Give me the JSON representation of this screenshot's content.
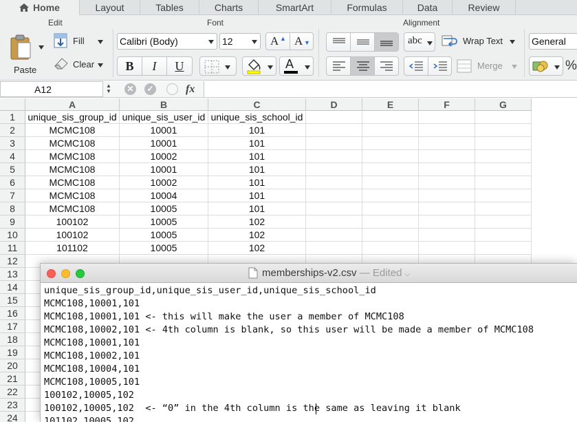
{
  "ribbon": {
    "tabs": [
      {
        "label": "Home",
        "active": true
      },
      {
        "label": "Layout"
      },
      {
        "label": "Tables"
      },
      {
        "label": "Charts"
      },
      {
        "label": "SmartArt"
      },
      {
        "label": "Formulas"
      },
      {
        "label": "Data"
      },
      {
        "label": "Review"
      }
    ],
    "groups": {
      "edit": "Edit",
      "font": "Font",
      "alignment": "Alignment"
    },
    "edit": {
      "paste": "Paste",
      "fill": "Fill",
      "clear": "Clear"
    },
    "font": {
      "name": "Calibri (Body)",
      "size": "12",
      "bold": "B",
      "italic": "I",
      "underline": "U",
      "increase": "A",
      "decrease": "A",
      "color_letter": "A"
    },
    "alignment": {
      "abc": "abc",
      "wrap_text": "Wrap Text",
      "merge": "Merge"
    },
    "number": {
      "format": "General",
      "percent": "%"
    }
  },
  "formula_bar": {
    "name_box": "A12",
    "fx": "fx",
    "value": ""
  },
  "sheet": {
    "columns": [
      "A",
      "B",
      "C",
      "D",
      "E",
      "F",
      "G"
    ],
    "rows": [
      "1",
      "2",
      "3",
      "4",
      "5",
      "6",
      "7",
      "8",
      "9",
      "10",
      "11",
      "12",
      "13",
      "14",
      "15",
      "16",
      "17",
      "18",
      "19",
      "20",
      "21",
      "22",
      "23",
      "24"
    ],
    "cells": [
      [
        "unique_sis_group_id",
        "unique_sis_user_id",
        "unique_sis_school_id"
      ],
      [
        "MCMC108",
        "10001",
        "101"
      ],
      [
        "MCMC108",
        "10001",
        "101"
      ],
      [
        "MCMC108",
        "10002",
        "101"
      ],
      [
        "MCMC108",
        "10001",
        "101"
      ],
      [
        "MCMC108",
        "10002",
        "101"
      ],
      [
        "MCMC108",
        "10004",
        "101"
      ],
      [
        "MCMC108",
        "10005",
        "101"
      ],
      [
        "100102",
        "10005",
        "102"
      ],
      [
        "100102",
        "10005",
        "102"
      ],
      [
        "101102",
        "10005",
        "102"
      ]
    ]
  },
  "editor": {
    "filename": "memberships-v2.csv",
    "status": "— Edited",
    "lines": [
      "unique_sis_group_id,unique_sis_user_id,unique_sis_school_id",
      "MCMC108,10001,101",
      "MCMC108,10001,101 <- this will make the user a member of MCMC108",
      "MCMC108,10002,101 <- 4th column is blank, so this user will be made a member of MCMC108",
      "MCMC108,10001,101",
      "MCMC108,10002,101",
      "MCMC108,10004,101",
      "MCMC108,10005,101",
      "100102,10005,102",
      "100102,10005,102  <- “0” in the 4th column is the same as leaving it blank",
      "101102,10005,102"
    ]
  }
}
